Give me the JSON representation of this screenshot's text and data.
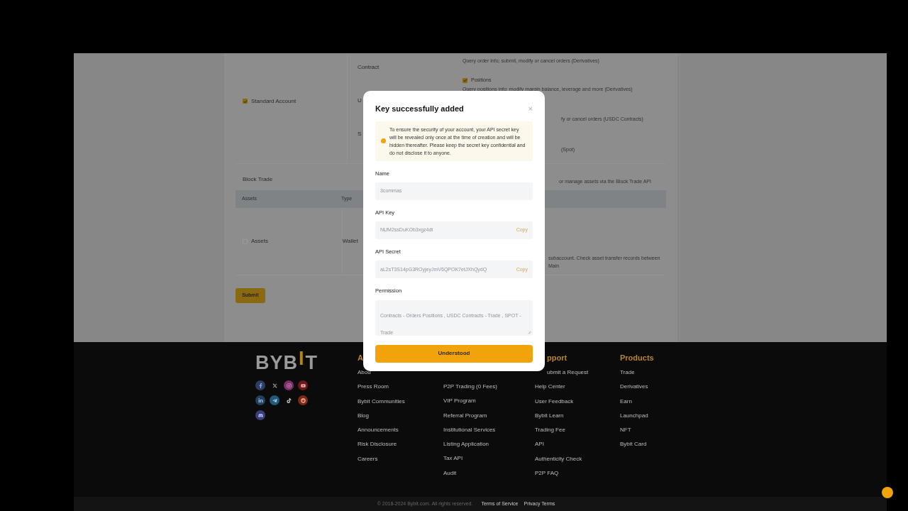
{
  "background": {
    "left_rows": [
      {
        "label": "Standard Account",
        "checked": true
      },
      {
        "label": "Block Trade"
      },
      {
        "label": "Assets",
        "checked": false
      }
    ],
    "contract_rows": [
      "Contract",
      "U",
      "S"
    ],
    "descriptions": [
      {
        "text": "Query order info; submit, modify or cancel orders (Derivatives)"
      },
      {
        "kind": "checkbox",
        "label": "Positions",
        "checked": true
      },
      {
        "text": "Query positions info; modify margin balance, leverage and more (Derivatives)"
      }
    ],
    "fragments": [
      "fy or cancel orders (USDC Contracts)",
      "(Spot)",
      "or manage assets via the Block Trade API",
      "subaccount. Check asset transfer records between Main"
    ],
    "table_header": [
      "Assets",
      "Type"
    ],
    "wallet": "Wallet",
    "submit": "Submit"
  },
  "dialog": {
    "title": "Key successfully added",
    "close": "×",
    "notice": "To ensure the security of your account, your API secret key will be revealed only once at the time of creation and will be hidden thereafter. Please keep the secret key confidential and do not disclose it to anyone.",
    "fields": [
      {
        "label": "Name",
        "value": "3commas"
      },
      {
        "label": "API Key",
        "value": "NUM2ssDuKOb3xgz4dt",
        "action": "Copy"
      },
      {
        "label": "API Secret",
        "value": "aL2sT3S14pG3ROyjeyJmV6QPOK7etJXhQydQ",
        "action": "Copy"
      }
    ],
    "permission": {
      "label": "Permission",
      "value": "Contracts - Orders Positions  , USDC Contracts - Trade  , SPOT - Trade"
    },
    "button": "Understood"
  },
  "footer": {
    "logo": [
      "BYB",
      "I",
      "T"
    ],
    "columns": [
      {
        "heading": "A",
        "links": [
          "Abou",
          "Press Room",
          "Bybit Communities",
          "Blog",
          "Announcements",
          "Risk Disclosure",
          "Careers"
        ]
      },
      {
        "links": [
          "P2P Trading (0 Fees)",
          "VIP Program",
          "Referral Program",
          "Institutional Services",
          "Listing Application",
          "Tax API",
          "Audit"
        ]
      },
      {
        "heading": "pport",
        "links": [
          "ubmit a Request",
          "Help Center",
          "User Feedback",
          "Bybit Learn",
          "Trading Fee",
          "API",
          "Authenticity Check",
          "P2P FAQ"
        ]
      },
      {
        "heading": "Products",
        "links": [
          "Trade",
          "Derivatives",
          "Earn",
          "Launchpad",
          "NFT",
          "Bybit Card"
        ]
      }
    ],
    "copyright": "© 2018-2024 Bybit.com. All rights reserved.",
    "legal_links": [
      "Terms of Service",
      "Privacy Terms"
    ]
  }
}
